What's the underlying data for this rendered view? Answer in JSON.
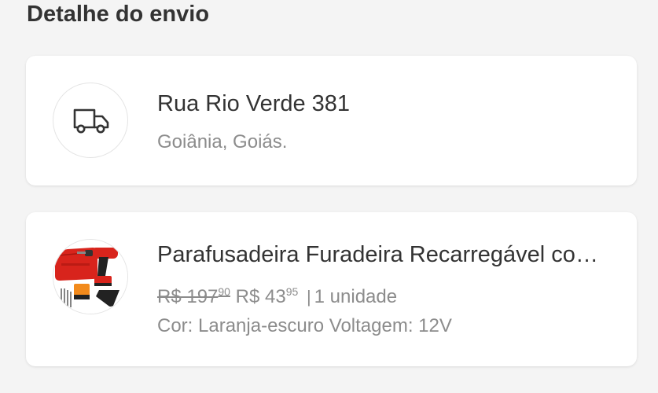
{
  "section_title": "Detalhe do envio",
  "address": {
    "icon": "truck-icon",
    "street": "Rua Rio Verde 381",
    "city": "Goiânia, Goiás."
  },
  "product": {
    "image": "cordless-drill-kit-image",
    "title": "Parafusadeira Furadeira Recarregável com Maleta",
    "old_price_int": "R$ 197",
    "old_price_cents": "90",
    "price_int": "R$ 43",
    "price_cents": "95",
    "separator": "|",
    "quantity": "1 unidade",
    "variant": "Cor: Laranja-escuro Voltagem: 12V"
  },
  "colors": {
    "background": "#f4f4f4",
    "card": "#ffffff",
    "text_primary": "#333333",
    "text_secondary": "#8c8c8c",
    "product_red": "#d8241c"
  }
}
